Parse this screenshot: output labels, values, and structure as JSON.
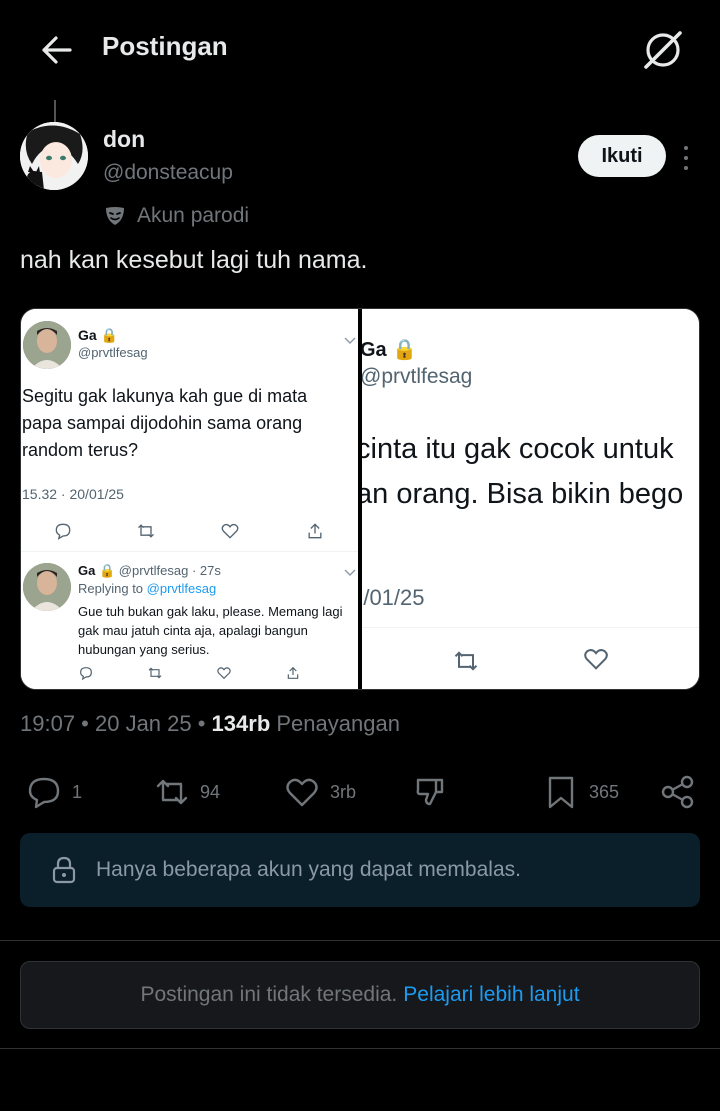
{
  "header": {
    "title": "Postingan"
  },
  "post": {
    "author_name": "don",
    "author_handle": "@donsteacup",
    "parody_label": "Akun parodi",
    "follow_label": "Ikuti",
    "text": "nah kan kesebut lagi tuh nama.",
    "timestamp": "19:07 • 20 Jan 25 • ",
    "views_count": "134rb",
    "views_label": " Penayangan"
  },
  "media": {
    "left": {
      "name": "Ga",
      "handle": "@prvtlfesag",
      "text": "Segitu gak lakunya kah gue di mata papa sampai dijodohin sama orang random terus?",
      "time": "15.32 · 20/01/25",
      "reply": {
        "name": "Ga",
        "handle_time": "@prvtlfesag · 27s",
        "replying_prefix": "Replying to ",
        "replying_handle": "@prvtlfesag",
        "text": "Gue tuh bukan gak laku, please. Memang lagi gak mau jatuh cinta aja, apalagi bangun hubungan yang serius."
      }
    },
    "right": {
      "name": "Ga",
      "handle": "@prvtlfesag",
      "line1": "cinta itu gak cocok untuk",
      "line2": "an orang. Bisa bikin bego",
      "time": ")/01/25"
    }
  },
  "actions": {
    "replies": "1",
    "reposts": "94",
    "likes": "3rb",
    "bookmarks": "365"
  },
  "restriction": {
    "text": "Hanya beberapa akun yang dapat membalas."
  },
  "unavailable": {
    "text": "Postingan ini tidak tersedia.",
    "link": "Pelajari lebih lanjut"
  },
  "colors": {
    "accent": "#1d9bf0",
    "background": "#000000",
    "muted": "#71767b"
  }
}
